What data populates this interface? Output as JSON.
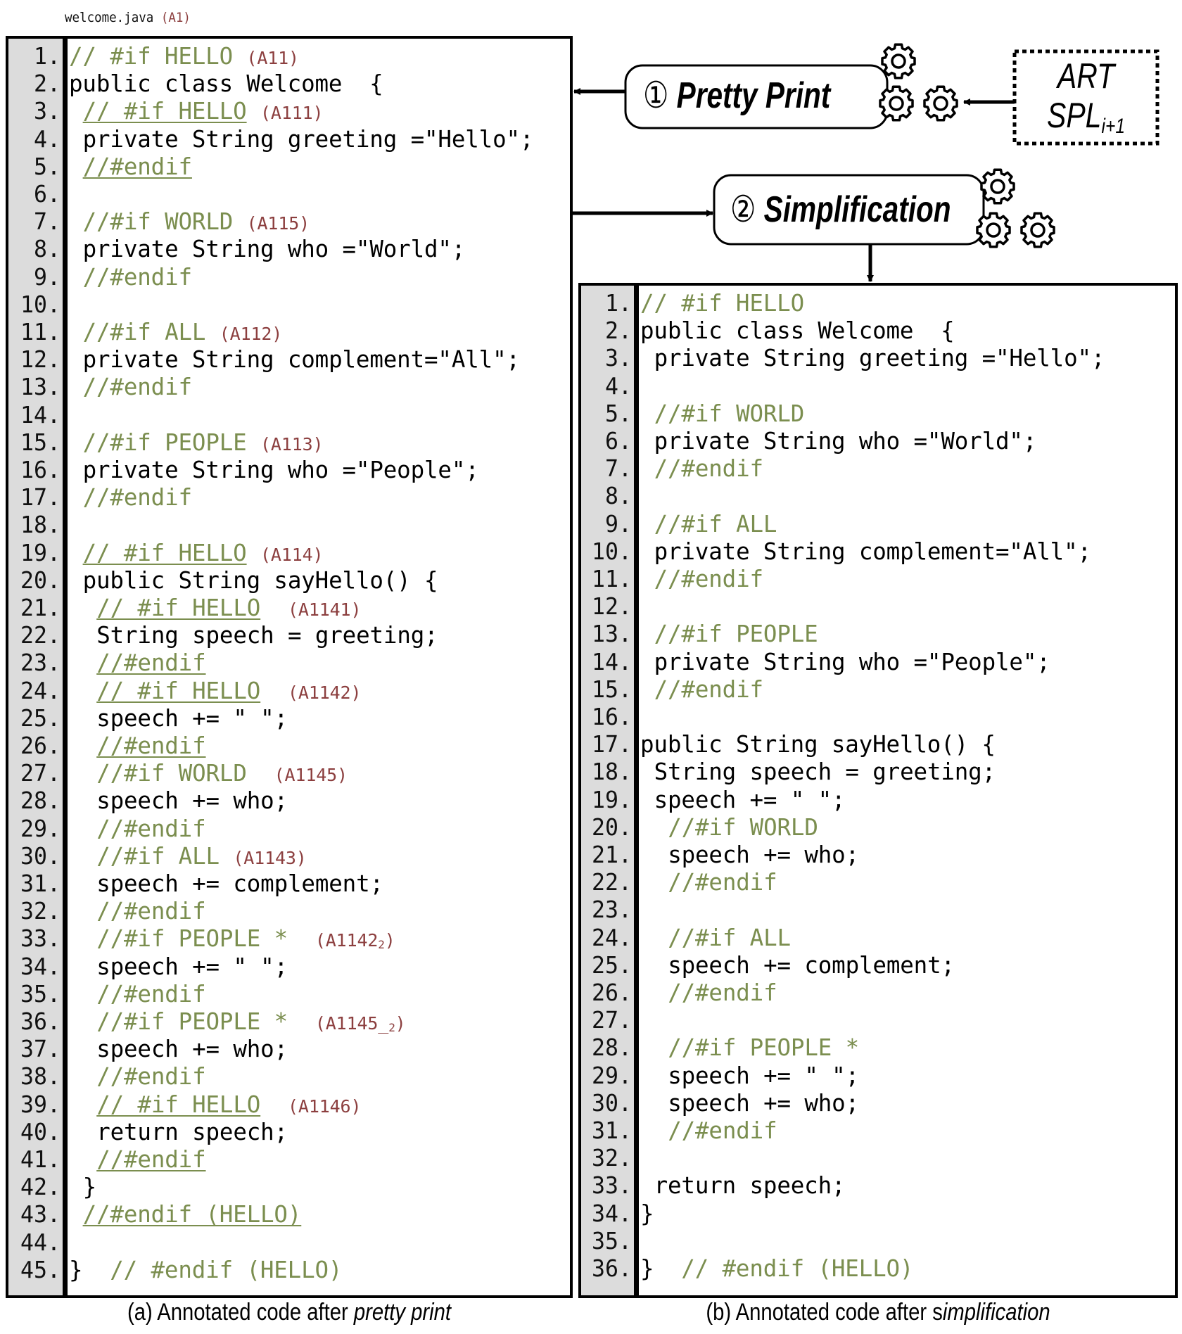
{
  "file_header": {
    "name": "welcome.java",
    "annotation": "(A1)"
  },
  "steps": {
    "pretty_print": {
      "number": "①",
      "label": "Pretty Print"
    },
    "simplification": {
      "number": "②",
      "label": "Simplification"
    },
    "source": {
      "line1": "ART",
      "line2_main": "SPL",
      "line2_sub": "i+1"
    }
  },
  "colors": {
    "comment": "#7b8e4f",
    "annotation": "#8c3f3f",
    "gutter": "#dcdcdc",
    "text": "#000000"
  },
  "left_panel": {
    "caption_prefix": "(a) Annotated code after ",
    "caption_italic": "pretty print",
    "lines": [
      {
        "n": "1.",
        "indent": 0,
        "parts": [
          {
            "t": "// #if HELLO",
            "k": "cmt"
          },
          {
            "t": " "
          },
          {
            "t": "(A11)",
            "k": "ann"
          }
        ]
      },
      {
        "n": "2.",
        "indent": 0,
        "parts": [
          {
            "t": "public class Welcome  {"
          }
        ]
      },
      {
        "n": "3.",
        "indent": 1,
        "parts": [
          {
            "t": "// #if HELLO",
            "k": "cmt",
            "u": true
          },
          {
            "t": " "
          },
          {
            "t": "(A111)",
            "k": "ann"
          }
        ]
      },
      {
        "n": "4.",
        "indent": 1,
        "parts": [
          {
            "t": "private String greeting =\"Hello\";"
          }
        ]
      },
      {
        "n": "5.",
        "indent": 1,
        "parts": [
          {
            "t": "//#endif",
            "k": "cmt",
            "u": true
          }
        ]
      },
      {
        "n": "6.",
        "indent": 0,
        "parts": []
      },
      {
        "n": "7.",
        "indent": 1,
        "parts": [
          {
            "t": "//#if WORLD",
            "k": "cmt"
          },
          {
            "t": " "
          },
          {
            "t": "(A115)",
            "k": "ann"
          }
        ]
      },
      {
        "n": "8.",
        "indent": 1,
        "parts": [
          {
            "t": "private String who =\"World\";"
          }
        ]
      },
      {
        "n": "9.",
        "indent": 1,
        "parts": [
          {
            "t": "//#endif",
            "k": "cmt"
          }
        ]
      },
      {
        "n": "10.",
        "indent": 0,
        "parts": []
      },
      {
        "n": "11.",
        "indent": 1,
        "parts": [
          {
            "t": "//#if ALL",
            "k": "cmt"
          },
          {
            "t": " "
          },
          {
            "t": "(A112)",
            "k": "ann"
          }
        ]
      },
      {
        "n": "12.",
        "indent": 1,
        "parts": [
          {
            "t": "private String complement=\"All\";"
          }
        ]
      },
      {
        "n": "13.",
        "indent": 1,
        "parts": [
          {
            "t": "//#endif",
            "k": "cmt"
          }
        ]
      },
      {
        "n": "14.",
        "indent": 0,
        "parts": []
      },
      {
        "n": "15.",
        "indent": 1,
        "parts": [
          {
            "t": "//#if PEOPLE",
            "k": "cmt"
          },
          {
            "t": " "
          },
          {
            "t": "(A113)",
            "k": "ann"
          }
        ]
      },
      {
        "n": "16.",
        "indent": 1,
        "parts": [
          {
            "t": "private String who =\"People\";"
          }
        ]
      },
      {
        "n": "17.",
        "indent": 1,
        "parts": [
          {
            "t": "//#endif",
            "k": "cmt"
          }
        ]
      },
      {
        "n": "18.",
        "indent": 0,
        "parts": []
      },
      {
        "n": "19.",
        "indent": 1,
        "parts": [
          {
            "t": "// #if HELLO",
            "k": "cmt",
            "u": true
          },
          {
            "t": " "
          },
          {
            "t": "(A114)",
            "k": "ann"
          }
        ]
      },
      {
        "n": "20.",
        "indent": 1,
        "parts": [
          {
            "t": "public String sayHello() {"
          }
        ]
      },
      {
        "n": "21.",
        "indent": 2,
        "parts": [
          {
            "t": "// #if HELLO",
            "k": "cmt",
            "u": true
          },
          {
            "t": "  "
          },
          {
            "t": "(A1141)",
            "k": "ann"
          }
        ]
      },
      {
        "n": "22.",
        "indent": 2,
        "parts": [
          {
            "t": "String speech = greeting;"
          }
        ]
      },
      {
        "n": "23.",
        "indent": 2,
        "parts": [
          {
            "t": "//#endif",
            "k": "cmt",
            "u": true
          }
        ]
      },
      {
        "n": "24.",
        "indent": 2,
        "parts": [
          {
            "t": "// #if HELLO",
            "k": "cmt",
            "u": true
          },
          {
            "t": "  "
          },
          {
            "t": "(A1142)",
            "k": "ann"
          }
        ]
      },
      {
        "n": "25.",
        "indent": 2,
        "parts": [
          {
            "t": "speech += \" \";"
          }
        ]
      },
      {
        "n": "26.",
        "indent": 2,
        "parts": [
          {
            "t": "//#endif",
            "k": "cmt",
            "u": true
          }
        ]
      },
      {
        "n": "27.",
        "indent": 2,
        "parts": [
          {
            "t": "//#if WORLD",
            "k": "cmt"
          },
          {
            "t": "  "
          },
          {
            "t": "(A1145)",
            "k": "ann"
          }
        ]
      },
      {
        "n": "28.",
        "indent": 2,
        "parts": [
          {
            "t": "speech += who;"
          }
        ]
      },
      {
        "n": "29.",
        "indent": 2,
        "parts": [
          {
            "t": "//#endif",
            "k": "cmt"
          }
        ]
      },
      {
        "n": "30.",
        "indent": 2,
        "parts": [
          {
            "t": "//#if ALL",
            "k": "cmt"
          },
          {
            "t": " "
          },
          {
            "t": "(A1143)",
            "k": "ann"
          }
        ]
      },
      {
        "n": "31.",
        "indent": 2,
        "parts": [
          {
            "t": "speech += complement;"
          }
        ]
      },
      {
        "n": "32.",
        "indent": 2,
        "parts": [
          {
            "t": "//#endif",
            "k": "cmt"
          }
        ]
      },
      {
        "n": "33.",
        "indent": 2,
        "parts": [
          {
            "t": "//#if PEOPLE *",
            "k": "cmt"
          },
          {
            "t": "  "
          },
          {
            "t": "(A1142",
            "k": "ann",
            "sub": "2",
            "after": ")"
          }
        ]
      },
      {
        "n": "34.",
        "indent": 2,
        "parts": [
          {
            "t": "speech += \" \";"
          }
        ]
      },
      {
        "n": "35.",
        "indent": 2,
        "parts": [
          {
            "t": "//#endif",
            "k": "cmt"
          }
        ]
      },
      {
        "n": "36.",
        "indent": 2,
        "parts": [
          {
            "t": "//#if PEOPLE *",
            "k": "cmt"
          },
          {
            "t": "  "
          },
          {
            "t": "(A1145_",
            "k": "ann",
            "sub": "2",
            "after": ")"
          }
        ]
      },
      {
        "n": "37.",
        "indent": 2,
        "parts": [
          {
            "t": "speech += who;"
          }
        ]
      },
      {
        "n": "38.",
        "indent": 2,
        "parts": [
          {
            "t": "//#endif",
            "k": "cmt"
          }
        ]
      },
      {
        "n": "39.",
        "indent": 2,
        "parts": [
          {
            "t": "// #if HELLO",
            "k": "cmt",
            "u": true
          },
          {
            "t": "  "
          },
          {
            "t": "(A1146)",
            "k": "ann"
          }
        ]
      },
      {
        "n": "40.",
        "indent": 2,
        "parts": [
          {
            "t": "return speech;"
          }
        ]
      },
      {
        "n": "41.",
        "indent": 2,
        "parts": [
          {
            "t": "//#endif",
            "k": "cmt",
            "u": true
          }
        ]
      },
      {
        "n": "42.",
        "indent": 1,
        "parts": [
          {
            "t": "}"
          }
        ]
      },
      {
        "n": "43.",
        "indent": 1,
        "parts": [
          {
            "t": "//#endif (HELLO)",
            "k": "cmt",
            "u": true
          }
        ]
      },
      {
        "n": "44.",
        "indent": 0,
        "parts": []
      },
      {
        "n": "45.",
        "indent": 0,
        "parts": [
          {
            "t": "}  "
          },
          {
            "t": "// #endif (HELLO)",
            "k": "cmt"
          }
        ]
      }
    ]
  },
  "right_panel": {
    "caption_prefix": "(b) Annotated code after s",
    "caption_italic": "implification",
    "lines": [
      {
        "n": "1.",
        "indent": 0,
        "parts": [
          {
            "t": "// #if HELLO",
            "k": "cmt"
          }
        ]
      },
      {
        "n": "2.",
        "indent": 0,
        "parts": [
          {
            "t": "public class Welcome  {"
          }
        ]
      },
      {
        "n": "3.",
        "indent": 1,
        "parts": [
          {
            "t": "private String greeting =\"Hello\";"
          }
        ]
      },
      {
        "n": "4.",
        "indent": 0,
        "parts": []
      },
      {
        "n": "5.",
        "indent": 1,
        "parts": [
          {
            "t": "//#if WORLD",
            "k": "cmt"
          }
        ]
      },
      {
        "n": "6.",
        "indent": 1,
        "parts": [
          {
            "t": "private String who =\"World\";"
          }
        ]
      },
      {
        "n": "7.",
        "indent": 1,
        "parts": [
          {
            "t": "//#endif",
            "k": "cmt"
          }
        ]
      },
      {
        "n": "8.",
        "indent": 0,
        "parts": []
      },
      {
        "n": "9.",
        "indent": 1,
        "parts": [
          {
            "t": "//#if ALL",
            "k": "cmt"
          }
        ]
      },
      {
        "n": "10.",
        "indent": 1,
        "parts": [
          {
            "t": "private String complement=\"All\";"
          }
        ]
      },
      {
        "n": "11.",
        "indent": 1,
        "parts": [
          {
            "t": "//#endif",
            "k": "cmt"
          }
        ]
      },
      {
        "n": "12.",
        "indent": 0,
        "parts": []
      },
      {
        "n": "13.",
        "indent": 1,
        "parts": [
          {
            "t": "//#if PEOPLE",
            "k": "cmt"
          }
        ]
      },
      {
        "n": "14.",
        "indent": 1,
        "parts": [
          {
            "t": "private String who =\"People\";"
          }
        ]
      },
      {
        "n": "15.",
        "indent": 1,
        "parts": [
          {
            "t": "//#endif",
            "k": "cmt"
          }
        ]
      },
      {
        "n": "16.",
        "indent": 0,
        "parts": []
      },
      {
        "n": "17.",
        "indent": 0,
        "parts": [
          {
            "t": "public String sayHello() {"
          }
        ]
      },
      {
        "n": "18.",
        "indent": 1,
        "parts": [
          {
            "t": "String speech = greeting;"
          }
        ]
      },
      {
        "n": "19.",
        "indent": 1,
        "parts": [
          {
            "t": "speech += \" \";"
          }
        ]
      },
      {
        "n": "20.",
        "indent": 2,
        "parts": [
          {
            "t": "//#if WORLD",
            "k": "cmt"
          }
        ]
      },
      {
        "n": "21.",
        "indent": 2,
        "parts": [
          {
            "t": "speech += who;"
          }
        ]
      },
      {
        "n": "22.",
        "indent": 2,
        "parts": [
          {
            "t": "//#endif",
            "k": "cmt"
          }
        ]
      },
      {
        "n": "23.",
        "indent": 0,
        "parts": []
      },
      {
        "n": "24.",
        "indent": 2,
        "parts": [
          {
            "t": "//#if ALL",
            "k": "cmt"
          }
        ]
      },
      {
        "n": "25.",
        "indent": 2,
        "parts": [
          {
            "t": "speech += complement;"
          }
        ]
      },
      {
        "n": "26.",
        "indent": 2,
        "parts": [
          {
            "t": "//#endif",
            "k": "cmt"
          }
        ]
      },
      {
        "n": "27.",
        "indent": 0,
        "parts": []
      },
      {
        "n": "28.",
        "indent": 2,
        "parts": [
          {
            "t": "//#if PEOPLE *",
            "k": "cmt"
          }
        ]
      },
      {
        "n": "29.",
        "indent": 2,
        "parts": [
          {
            "t": "speech += \" \";"
          }
        ]
      },
      {
        "n": "30.",
        "indent": 2,
        "parts": [
          {
            "t": "speech += who;"
          }
        ]
      },
      {
        "n": "31.",
        "indent": 2,
        "parts": [
          {
            "t": "//#endif",
            "k": "cmt"
          }
        ]
      },
      {
        "n": "32.",
        "indent": 0,
        "parts": []
      },
      {
        "n": "33.",
        "indent": 1,
        "parts": [
          {
            "t": "return speech;"
          }
        ]
      },
      {
        "n": "34.",
        "indent": 0,
        "parts": [
          {
            "t": "}"
          }
        ]
      },
      {
        "n": "35.",
        "indent": 0,
        "parts": []
      },
      {
        "n": "36.",
        "indent": 0,
        "parts": [
          {
            "t": "}  "
          },
          {
            "t": "// #endif (HELLO)",
            "k": "cmt"
          }
        ]
      }
    ]
  }
}
